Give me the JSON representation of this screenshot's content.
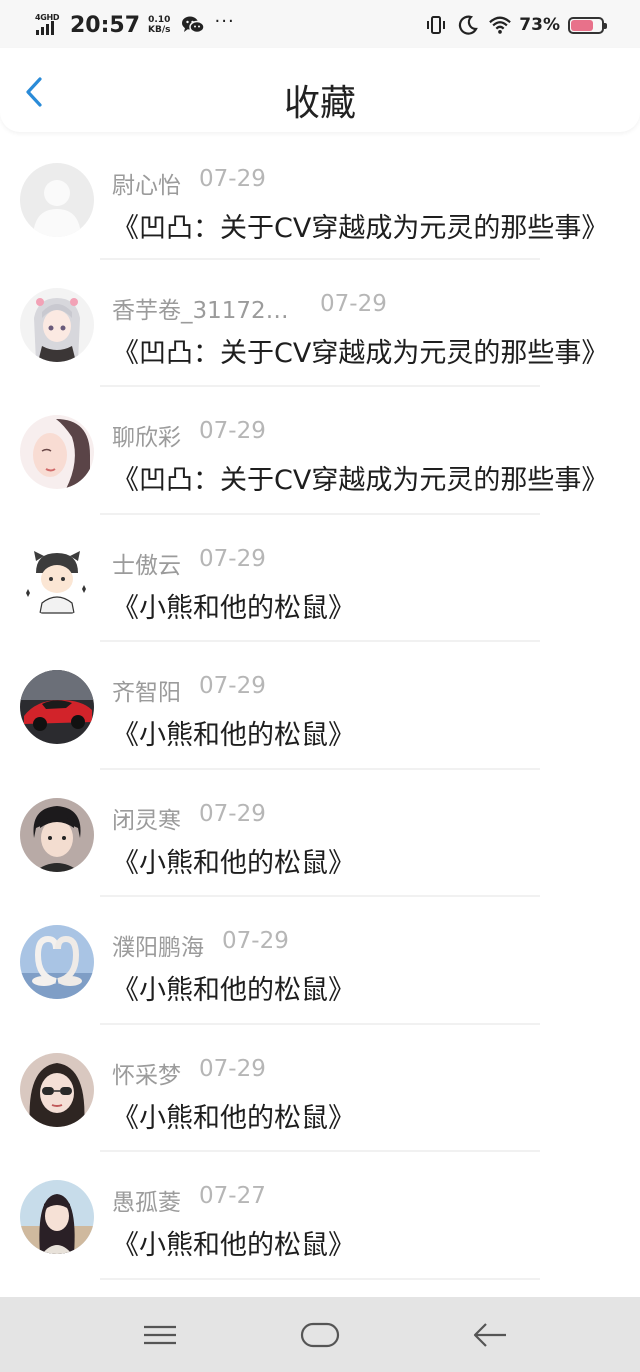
{
  "status_bar": {
    "network": "4GHD",
    "time": "20:57",
    "speed_value": "0.10",
    "speed_unit": "KB/s",
    "more": "···",
    "battery_percent": "73%",
    "battery_level": 0.73,
    "battery_color": "#e8718a",
    "icons": [
      "wechat-icon",
      "vibrate-icon",
      "moon-icon",
      "wifi-icon",
      "battery-icon"
    ]
  },
  "header": {
    "back_icon": "chevron-left-icon",
    "title": "收藏",
    "accent_color": "#2a8bd8"
  },
  "favorites": [
    {
      "name": "尉心怡",
      "date": "07-29",
      "title": "《凹凸：关于CV穿越成为元灵的那些事》",
      "avatar": "default-avatar"
    },
    {
      "name": "香芋卷_311727...",
      "date": "07-29",
      "title": "《凹凸：关于CV穿越成为元灵的那些事》",
      "avatar": "anime-girl-avatar"
    },
    {
      "name": "聊欣彩",
      "date": "07-29",
      "title": "《凹凸：关于CV穿越成为元灵的那些事》",
      "avatar": "portrait-avatar"
    },
    {
      "name": "士傲云",
      "date": "07-29",
      "title": "《小熊和他的松鼠》",
      "avatar": "cartoon-boy-avatar"
    },
    {
      "name": "齐智阳",
      "date": "07-29",
      "title": "《小熊和他的松鼠》",
      "avatar": "red-car-avatar"
    },
    {
      "name": "闭灵寒",
      "date": "07-29",
      "title": "《小熊和他的松鼠》",
      "avatar": "young-man-avatar"
    },
    {
      "name": "濮阳鹏海",
      "date": "07-29",
      "title": "《小熊和他的松鼠》",
      "avatar": "swans-avatar"
    },
    {
      "name": "怀采梦",
      "date": "07-29",
      "title": "《小熊和他的松鼠》",
      "avatar": "sunglasses-woman-avatar"
    },
    {
      "name": "愚孤菱",
      "date": "07-27",
      "title": "《小熊和他的松鼠》",
      "avatar": "girl-outdoor-avatar"
    }
  ],
  "nav_bar": {
    "icons": [
      "menu-icon",
      "home-icon",
      "back-arrow-icon"
    ]
  }
}
